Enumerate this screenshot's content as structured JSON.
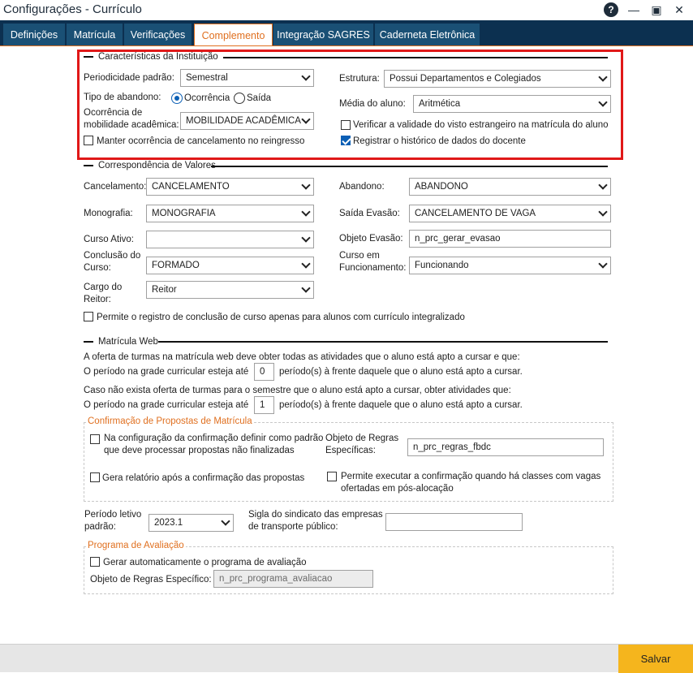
{
  "window": {
    "title": "Configurações - Currículo"
  },
  "tabs": [
    {
      "label": "Definições"
    },
    {
      "label": "Matrícula"
    },
    {
      "label": "Verificações"
    },
    {
      "label": "Complemento"
    },
    {
      "label": "Integração SAGRES"
    },
    {
      "label": "Caderneta Eletrônica"
    }
  ],
  "characteristics": {
    "title": "Características da Instituição",
    "periodicidade_label": "Periodicidade padrão:",
    "periodicidade_value": "Semestral",
    "estrutura_label": "Estrutura:",
    "estrutura_value": "Possui Departamentos e Colegiados",
    "tipo_abandono_label": "Tipo de abandono:",
    "radio_ocorrencia": "Ocorrência",
    "radio_saida": "Saída",
    "media_label": "Média do aluno:",
    "media_value": "Aritmética",
    "mobilidade_label_1": "Ocorrência de",
    "mobilidade_label_2": "mobilidade acadêmica:",
    "mobilidade_value": "MOBILIDADE ACADÊMICA",
    "visto_label": "Verificar a validade do visto estrangeiro na matrícula do aluno",
    "manter_label": "Manter ocorrência de cancelamento no reingresso",
    "registrar_label": "Registrar o histórico de dados do docente"
  },
  "correspondence": {
    "title": "Correspondência de Valores",
    "cancelamento_label": "Cancelamento:",
    "cancelamento_value": "CANCELAMENTO",
    "abandono_label": "Abandono:",
    "abandono_value": "ABANDONO",
    "monografia_label": "Monografia:",
    "monografia_value": "MONOGRAFIA",
    "saida_label": "Saída Evasão:",
    "saida_value": "CANCELAMENTO DE VAGA",
    "curso_ativo_label": "Curso Ativo:",
    "curso_ativo_value": "",
    "objeto_evasao_label": "Objeto Evasão:",
    "objeto_evasao_value": "n_prc_gerar_evasao",
    "conclusao_label_1": "Conclusão do",
    "conclusao_label_2": "Curso:",
    "conclusao_value": "FORMADO",
    "funcionamento_label_1": "Curso em",
    "funcionamento_label_2": "Funcionamento:",
    "funcionamento_value": "Funcionando",
    "cargo_label_1": "Cargo do",
    "cargo_label_2": "Reitor:",
    "cargo_value": "Reitor",
    "permite_label": "Permite o registro de conclusão de curso apenas para alunos com currículo integralizado"
  },
  "matricula_web": {
    "title": "Matrícula Web",
    "text1": "A oferta de turmas na matrícula web deve obter todas as atividades que o aluno está apto a cursar e que:",
    "text2_a": "O período na grade curricular esteja até",
    "value1": "0",
    "text2_b": "período(s) à frente daquele que o aluno está apto a cursar.",
    "text3": "Caso não exista oferta de turmas para o semestre que o aluno está apto a cursar, obter atividades que:",
    "text4_a": "O período na grade curricular esteja até",
    "value2": "1",
    "text4_b": "período(s) à frente daquele que o aluno está apto a cursar."
  },
  "confirmacao": {
    "title": "Confirmação de Propostas de Matrícula",
    "nao_finalizadas_1": "Na configuração da confirmação definir como padrão",
    "nao_finalizadas_2": "que deve processar propostas não finalizadas",
    "objeto_regras_label_1": "Objeto de Regras",
    "objeto_regras_label_2": "Específicas:",
    "objeto_regras_value": "n_prc_regras_fbdc",
    "gera_relatorio": "Gera relatório após a confirmação das propostas",
    "permite_exec_1": "Permite executar a confirmação quando há classes com vagas",
    "permite_exec_2": "ofertadas em pós-alocação"
  },
  "periodo": {
    "label_1": "Período letivo",
    "label_2": "padrão:",
    "value": "2023.1",
    "sigla_label_1": "Sigla do sindicato das empresas",
    "sigla_label_2": "de transporte público:",
    "sigla_value": ""
  },
  "programa": {
    "title": "Programa de Avaliação",
    "gerar_label": "Gerar automaticamente o programa de avaliação",
    "objeto_label": "Objeto de Regras Específico:",
    "objeto_value": "n_prc_programa_avaliacao"
  },
  "footer": {
    "save_label": "Salvar"
  },
  "colors": {
    "accent": "#e07020",
    "nav": "#0c3050",
    "tab": "#1a5075",
    "save": "#f5b51d",
    "highlight": "#e01818"
  }
}
